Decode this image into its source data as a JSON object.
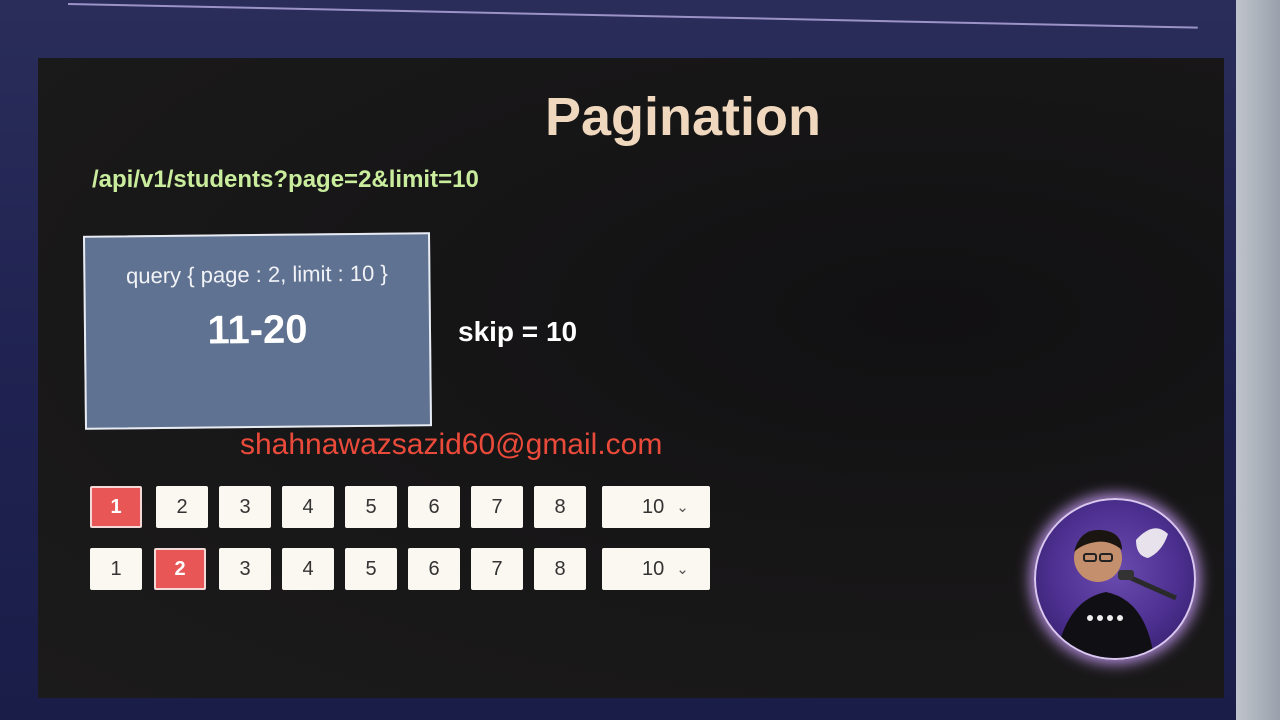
{
  "slide": {
    "title": "Pagination",
    "endpoint": "/api/v1/students?page=2&limit=10",
    "query_card": {
      "query": "query { page : 2, limit : 10 }",
      "range": "11-20"
    },
    "skip": "skip = 10",
    "email": "shahnawazsazid60@gmail.com"
  },
  "pagination_rows": [
    {
      "pages": [
        "1",
        "2",
        "3",
        "4",
        "5",
        "6",
        "7",
        "8"
      ],
      "active": "1",
      "limit": "10"
    },
    {
      "pages": [
        "1",
        "2",
        "3",
        "4",
        "5",
        "6",
        "7",
        "8"
      ],
      "active": "2",
      "limit": "10"
    }
  ],
  "colors": {
    "title": "#efd8be",
    "endpoint": "#c9ec9d",
    "card": "#5f7291",
    "email": "#ea4a3a",
    "active_page": "#e85656"
  },
  "icons": {
    "dropdown": "chevron-down-icon"
  }
}
